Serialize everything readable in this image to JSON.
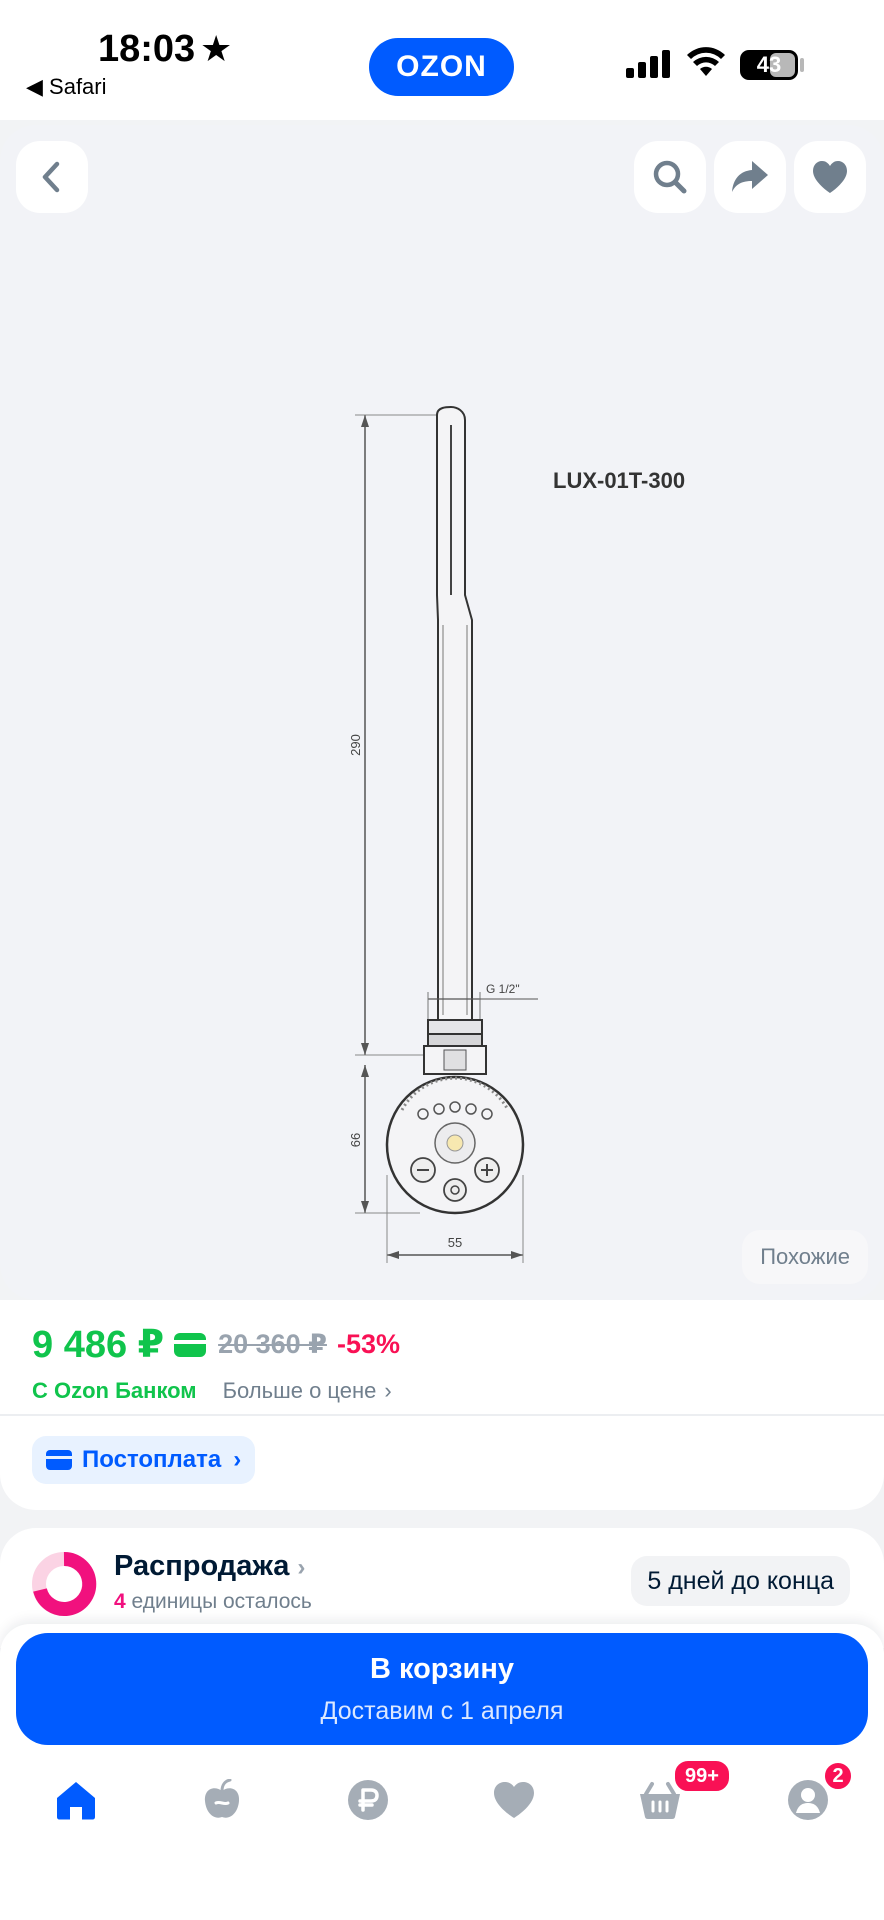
{
  "status_bar": {
    "time": "18:03",
    "back_app": "◀ Safari",
    "battery": "43"
  },
  "header": {
    "logo": "OZON"
  },
  "gallery": {
    "model_label": "LUX-01T-300",
    "dim_height": "290",
    "dim_thread": "G 1/2\"",
    "dim_body": "66",
    "dim_width": "55",
    "similar_label": "Похожие",
    "icons": [
      "back-arrow-icon",
      "search-icon",
      "share-icon",
      "heart-icon"
    ]
  },
  "price": {
    "current": "9 486 ₽",
    "old": "20 360 ₽",
    "discount": "-53%",
    "bank_label": "С Ozon Банком",
    "more_label": "Больше о цене",
    "postpay_label": "Постоплата"
  },
  "sale": {
    "title": "Распродажа",
    "count": "4",
    "remaining_label": " единицы осталось",
    "days_label": "5 дней до конца"
  },
  "cta": {
    "title": "В корзину",
    "subtitle": "Доставим с 1 апреля"
  },
  "tabbar": {
    "items": [
      "home-icon",
      "fresh-icon",
      "finance-icon",
      "favorites-icon",
      "cart-icon",
      "profile-icon"
    ],
    "cart_badge": "99+",
    "profile_badge": "2"
  },
  "colors": {
    "brand": "#005bff",
    "price_green": "#10c44c",
    "discount_red": "#f91155",
    "sale_pink": "#f1117e"
  }
}
